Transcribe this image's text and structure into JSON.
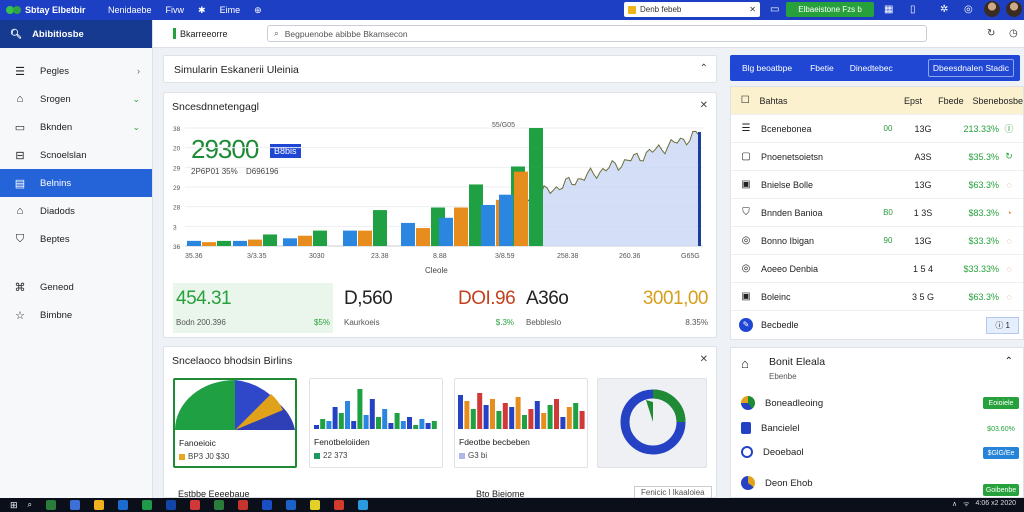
{
  "topbar": {
    "app_name": "Sbtay Elbetbir",
    "nav": [
      "Nenidaebe",
      "Fivw",
      "✱",
      "Eime"
    ],
    "search_value": "Denb febeb",
    "green_button": "Elbaeistone Fzs b",
    "colors": {
      "bar": "#1d3fc4",
      "button": "#27a13c"
    }
  },
  "sidebar": {
    "header": "Abibitiosbe",
    "items": [
      {
        "label": "Pegles",
        "icon": "list-icon",
        "chevron": "›"
      },
      {
        "label": "Srogen",
        "icon": "home-icon",
        "chevron": "⌄"
      },
      {
        "label": "Bknden",
        "icon": "folder-icon",
        "chevron": "⌄"
      },
      {
        "label": "Scnoelslan",
        "icon": "document-icon",
        "chevron": ""
      },
      {
        "label": "Belnins",
        "icon": "grid-icon",
        "chevron": "",
        "active": true
      },
      {
        "label": "Diadods",
        "icon": "archive-icon",
        "chevron": ""
      },
      {
        "label": "Beptes",
        "icon": "shield-icon",
        "chevron": ""
      },
      {
        "label": "Geneod",
        "icon": "network-icon",
        "chevron": ""
      },
      {
        "label": "Bimbne",
        "icon": "star-icon",
        "chevron": ""
      }
    ]
  },
  "subbar": {
    "tab_label": "Bkarreeorre",
    "search_placeholder": "Begpuenobe abibbe Bkamsecon"
  },
  "panel_collapsed": {
    "title": "Simularin Eskanerii Uleinia"
  },
  "chart_panel": {
    "title": "Sncesdnnetengagl",
    "big_value": "29300",
    "badge": "B8bis",
    "sub_values": [
      "2P6P01 35%",
      "D696196"
    ],
    "x_labels": [
      "35.36",
      "3/3.35",
      "3030",
      "23.38",
      "8.88",
      "3/8.59",
      "258.38",
      "260.36",
      "G65G"
    ],
    "x_top_label": "55/G05",
    "x_caption": "Cleole",
    "y_labels": [
      "38",
      "20",
      "29",
      "29",
      "28",
      "3",
      "36"
    ]
  },
  "chart_data": {
    "type": "bar",
    "categories": [
      "35.36",
      "3/3.35",
      "3030",
      "23.38",
      "8.88",
      "3/8.59"
    ],
    "series": [
      {
        "values": [
          4,
          4,
          6,
          12,
          18,
          22,
          32,
          40
        ]
      },
      {
        "values": [
          3,
          5,
          8,
          12,
          14,
          30,
          36,
          58
        ]
      },
      {
        "values": [
          4,
          9,
          12,
          28,
          30,
          48,
          62,
          92
        ]
      }
    ]
  },
  "stats": [
    {
      "value": "454.31",
      "sup": "♂",
      "label": "Bodn 200.396",
      "pct": "$5%",
      "color": "#27a13c"
    },
    {
      "value": "D,560",
      "label": "Kaurkoeis",
      "pct": "$.3%",
      "color": "#222"
    },
    {
      "value": "DOI.96",
      "label": "",
      "pct": "",
      "color": "#c4411e"
    },
    {
      "value": "A36o",
      "label": "Bebbleslo",
      "pct": "",
      "color": "#222"
    },
    {
      "value": "3001,00",
      "label": "",
      "pct": "8.35%",
      "color": "#d6a01e"
    }
  ],
  "panel_lower": {
    "title": "Sncelaoco bhodsin Birlins",
    "minis": [
      {
        "label": "Fanoeioic",
        "value": "BP3 J0 $30",
        "swatch": "#e6a820"
      },
      {
        "label": "Fenotbeloiiden",
        "value": "22 373",
        "swatch": "#1a9a5c"
      },
      {
        "label": "Fdeotbe becbeben",
        "value": "G3 bi",
        "swatch": "#aeb8e8"
      }
    ],
    "footer_left": "Estbbe Eeeebaue",
    "footer_mid": "Bto Bieiome",
    "footer_right": "Fenicic l Ikaaloiea"
  },
  "right_header": {
    "buttons": [
      "Blg beoatbpe",
      "Fbetie",
      "Dinedtebec",
      "Dbeesdnalen Stadic"
    ]
  },
  "right_table": {
    "header": {
      "name": "Bahtas",
      "c2": "",
      "c3": "Epst",
      "c4": "Fbede",
      "c5": "Sbenebosbe"
    },
    "rows": [
      {
        "icon": "list-icon",
        "name": "Bcenebonea",
        "c2": "00",
        "c3": "13G",
        "c4": "213.33%",
        "c5": "Ⓘ",
        "c5color": "#27a13c"
      },
      {
        "icon": "box-icon",
        "name": "Pnoenetsoietsn",
        "c2": "",
        "c3": "A3S",
        "c4": "$35.3%",
        "c5": "↻",
        "c5color": "#27a13c"
      },
      {
        "icon": "image-icon",
        "name": "Bnielse Bolle",
        "c2": "",
        "c3": "13G",
        "c4": "$63.3%",
        "c5": "◌",
        "c5color": "#e07a1c"
      },
      {
        "icon": "tag-icon",
        "name": "Bnnden Banioa",
        "c2": "B0",
        "c3": "1 3S",
        "c4": "$83.3%",
        "c5": "◔",
        "c5color": "#e07a1c"
      },
      {
        "icon": "target-icon",
        "name": "Bonno Ibigan",
        "c2": "90",
        "c3": "13G",
        "c4": "$33.3%",
        "c5": "◌",
        "c5color": "#e07a1c"
      },
      {
        "icon": "settings-icon",
        "name": "Aoeeo Denbia",
        "c2": "",
        "c3": "1 5 4",
        "c4": "$33.33%",
        "c5": "◌",
        "c5color": "#e07a1c"
      },
      {
        "icon": "chart-icon",
        "name": "Boleinc",
        "c2": "",
        "c3": "3 5 G",
        "c4": "$63.3%",
        "c5": "◌",
        "c5color": "#e07a1c"
      }
    ],
    "footer_label": "Becbedle",
    "footer_badge": "ⓘ 1"
  },
  "right_lower": {
    "title": "Bonit Eleala",
    "subtitle": "Ebenbe",
    "rows": [
      {
        "label": "Boneadleoing",
        "badge": "Eoioiele",
        "badge_color": "#27a13c"
      },
      {
        "label": "Bancielel",
        "badge": "$03.60%",
        "badge_color": "#27a13c"
      },
      {
        "label": "Deoebaol",
        "badge": "$GlG/Ee",
        "badge_color": "#2584d8"
      },
      {
        "label": "Deon Ehob",
        "badge": "Goibenbe",
        "badge_color": "#27a13c"
      }
    ]
  },
  "taskbar": {
    "tray": [
      "∧",
      "ᯤ",
      "4:06 x2 2020"
    ]
  }
}
